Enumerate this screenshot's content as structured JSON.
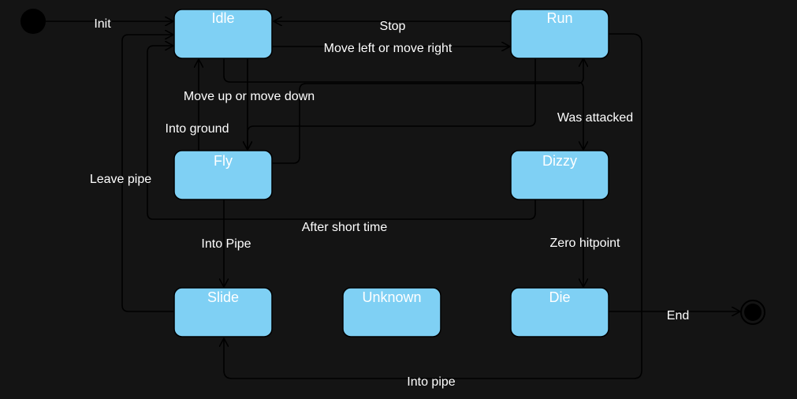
{
  "diagram": {
    "states": {
      "idle": "Idle",
      "run": "Run",
      "fly": "Fly",
      "dizzy": "Dizzy",
      "slide": "Slide",
      "unknown": "Unknown",
      "die": "Die"
    },
    "transitions": {
      "init": "Init",
      "stop": "Stop",
      "move_lr": "Move left or move right",
      "move_ud": "Move up or move down",
      "into_ground": "Into ground",
      "was_attacked": "Was attacked",
      "leave_pipe": "Leave pipe",
      "after_short_time": "After short time",
      "into_pipe_fly": "Into Pipe",
      "zero_hitpoint": "Zero hitpoint",
      "end": "End",
      "into_pipe_run": "Into pipe"
    },
    "colors": {
      "background": "#141414",
      "state_fill": "#7fd0f4",
      "line": "#000000",
      "text": "#ffffff"
    }
  }
}
